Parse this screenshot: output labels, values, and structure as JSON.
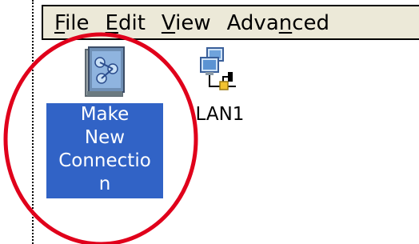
{
  "menu": {
    "items": [
      {
        "label_pre": "",
        "label_acc": "F",
        "label_post": "ile"
      },
      {
        "label_pre": "",
        "label_acc": "E",
        "label_post": "dit"
      },
      {
        "label_pre": "",
        "label_acc": "V",
        "label_post": "iew"
      },
      {
        "label_pre": "Adva",
        "label_acc": "n",
        "label_post": "ced"
      }
    ]
  },
  "icons": {
    "make_new_connection": {
      "label": "Make\nNew\nConnectio\nn",
      "icon": "make-new-connection-icon",
      "selected": true
    },
    "lan1": {
      "label": "LAN1",
      "icon": "network-lan-icon",
      "selected": false
    }
  },
  "colors": {
    "selection": "#3163c6",
    "menubar": "#ece9d8",
    "annotation": "#e0001b"
  }
}
